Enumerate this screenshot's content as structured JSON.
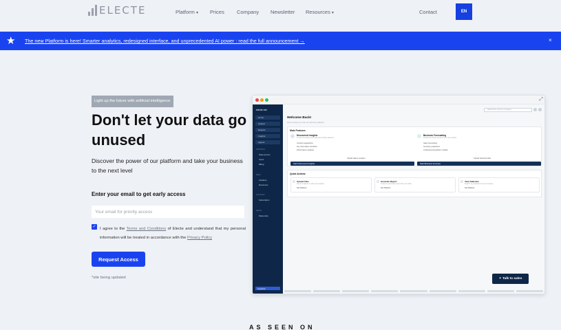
{
  "nav": {
    "logo_text": "ELECTE",
    "links": [
      {
        "label": "Platform",
        "dropdown": true
      },
      {
        "label": "Prices",
        "dropdown": false
      },
      {
        "label": "Company",
        "dropdown": false
      },
      {
        "label": "Newsletter",
        "dropdown": false
      },
      {
        "label": "Resources",
        "dropdown": true
      }
    ],
    "contact": "Contact",
    "lang": "EN"
  },
  "banner": {
    "message": "The new Platform is here! Smarter analytics, redesigned interface, and unprecedented AI power : read the full announcement →",
    "close": "×"
  },
  "hero": {
    "tag": "Light up the future with artificial intelligence",
    "headline": "Don't let your data go unused",
    "subtext": "Discover the power of our platform and take your business to the next level",
    "email_label": "Enter your email to get early access",
    "email_placeholder": "Your email for priority access",
    "consent_pre": "I agree to the ",
    "terms_link": "Terms and Conditions",
    "consent_mid": " of Electe and understand that my personal information will be treated in accordance with the ",
    "privacy_link": "Privacy Policy",
    "button": "Request Access",
    "note": "*site being updated"
  },
  "dashboard": {
    "brand": "electe.net",
    "side_items": [
      "Home",
      "Upload",
      "Reports",
      "Insights",
      "Agents"
    ],
    "side_sections": [
      {
        "title": "SETTINGS",
        "links": [
          "Data sources",
          "Users",
          "Billing"
        ]
      },
      {
        "title": "HELP",
        "links": [
          "Academy",
          "Resources"
        ]
      },
      {
        "title": "ACCOUNT",
        "links": [
          "Subscription"
        ]
      },
      {
        "title": "LEGAL",
        "links": [
          "Data policy"
        ]
      }
    ],
    "upgrade": "Upgrade",
    "search_placeholder": "Search this report or company",
    "welcome": "Welcome Back!",
    "welcome_sub": "Here's what you can do with the platform",
    "main_features_title": "Main Features",
    "features": [
      {
        "name": "Discovered Insights",
        "desc": "Let the AI explore your data and surface patterns",
        "items": [
          "Content suggestions",
          "Key information extraction",
          "Performance analysis"
        ],
        "right": "Upload data to analyze",
        "button": "Start Discovered Insights"
      },
      {
        "name": "Business Forecasting",
        "desc": "Predict the future trends of your key metrics",
        "items": [
          "Sales forecasting",
          "Inventory projections",
          "AI advanced prediction models"
        ],
        "right": "Upload historical data",
        "button": "Start Business Forecast"
      }
    ],
    "quick_actions_title": "Quick Actions",
    "quick_actions": [
      {
        "name": "Upload Files",
        "desc": "Import a dataset to start your analysis",
        "button": "Get Started ›"
      },
      {
        "name": "Generate Report",
        "desc": "Create an automatic report from your data",
        "button": "Get Started ›"
      },
      {
        "name": "View Statistics",
        "desc": "Explore key statistics for your company",
        "button": "Get Started ›"
      }
    ],
    "talk_button": "Talk to sales"
  },
  "footer": {
    "as_seen_on": "AS SEEN ON"
  },
  "colors": {
    "accent": "#1a43f0",
    "navy": "#0e2748",
    "background": "#eef1f6"
  }
}
